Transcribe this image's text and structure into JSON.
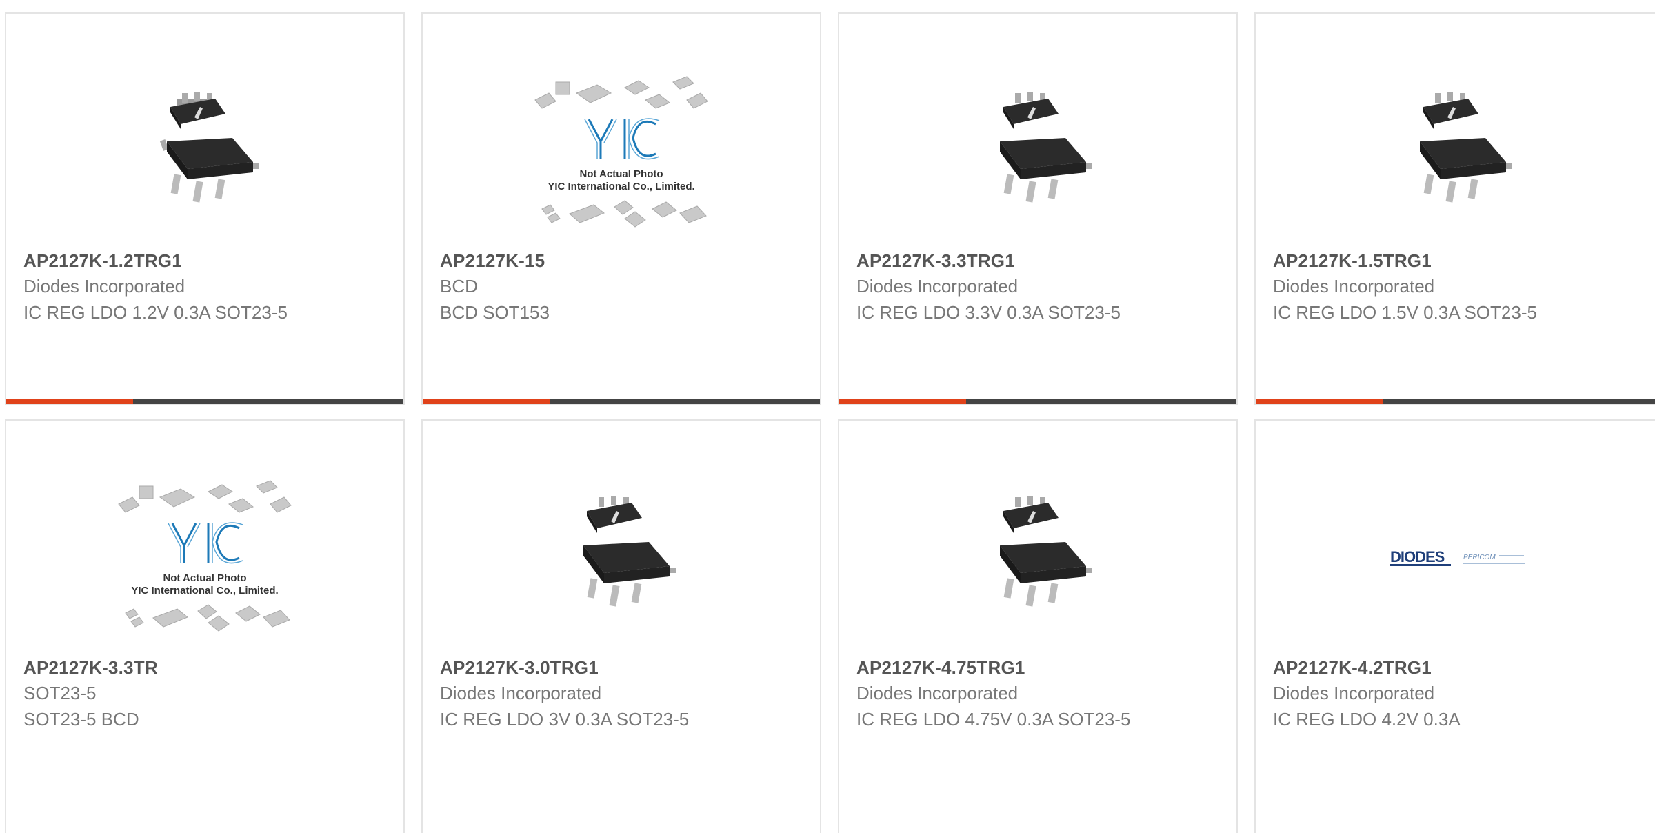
{
  "products": [
    {
      "part": "AP2127K-1.2TRG1",
      "maker": "Diodes Incorporated",
      "desc": "IC REG LDO 1.2V 0.3A SOT23-5",
      "image": "chip"
    },
    {
      "part": "AP2127K-15",
      "maker": "BCD",
      "desc": "BCD SOT153",
      "image": "yic"
    },
    {
      "part": "AP2127K-3.3TRG1",
      "maker": "Diodes Incorporated",
      "desc": "IC REG LDO 3.3V 0.3A SOT23-5",
      "image": "chip"
    },
    {
      "part": "AP2127K-1.5TRG1",
      "maker": "Diodes Incorporated",
      "desc": "IC REG LDO 1.5V 0.3A SOT23-5",
      "image": "chip"
    },
    {
      "part": "AP2127K-3.3TR",
      "maker": "SOT23-5",
      "desc": "SOT23-5 BCD",
      "image": "yic"
    },
    {
      "part": "AP2127K-3.0TRG1",
      "maker": "Diodes Incorporated",
      "desc": "IC REG LDO 3V 0.3A SOT23-5",
      "image": "chip"
    },
    {
      "part": "AP2127K-4.75TRG1",
      "maker": "Diodes Incorporated",
      "desc": "IC REG LDO 4.75V 0.3A SOT23-5",
      "image": "chip"
    },
    {
      "part": "AP2127K-4.2TRG1",
      "maker": "Diodes Incorporated",
      "desc": "IC REG LDO 4.2V 0.3A",
      "image": "diodes"
    }
  ],
  "placeholder": {
    "line1": "Not Actual Photo",
    "line2": "YIC International Co., Limited.",
    "logo": "YIC"
  },
  "diodes_logo": {
    "brand": "DIODES",
    "sub": "PERICOM"
  },
  "colors": {
    "accent": "#e0421a",
    "bar": "#444444",
    "border": "#e4e4e4"
  }
}
